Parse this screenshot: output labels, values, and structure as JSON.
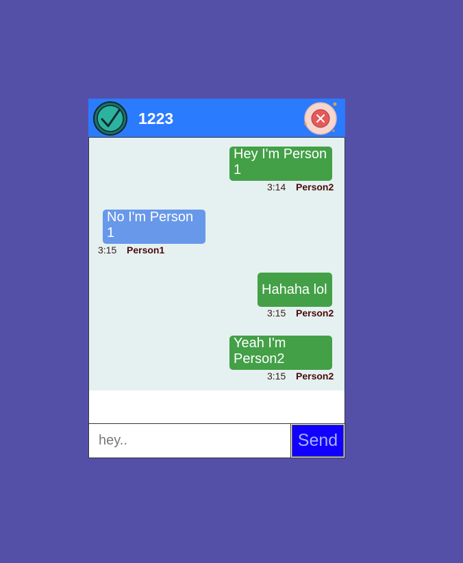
{
  "header": {
    "room_name": "1223",
    "status_icon": "check-circle-icon",
    "close_icon": "close-icon"
  },
  "messages": [
    {
      "text": "Hey I'm Person 1",
      "time": "3:14",
      "author": "Person2",
      "side": "right"
    },
    {
      "text": "No I'm Person 1",
      "time": "3:15",
      "author": "Person1",
      "side": "left"
    },
    {
      "text": "Hahaha lol",
      "time": "3:15",
      "author": "Person2",
      "side": "right"
    },
    {
      "text": "Yeah I'm Person2",
      "time": "3:15",
      "author": "Person2",
      "side": "right"
    }
  ],
  "footer": {
    "input_placeholder": "hey..",
    "input_value": "",
    "send_label": "Send"
  },
  "colors": {
    "background": "#5450a8",
    "header": "#2b7bff",
    "mine_bubble": "#43a047",
    "their_bubble": "#6898ea",
    "send_button": "#1100ff"
  }
}
